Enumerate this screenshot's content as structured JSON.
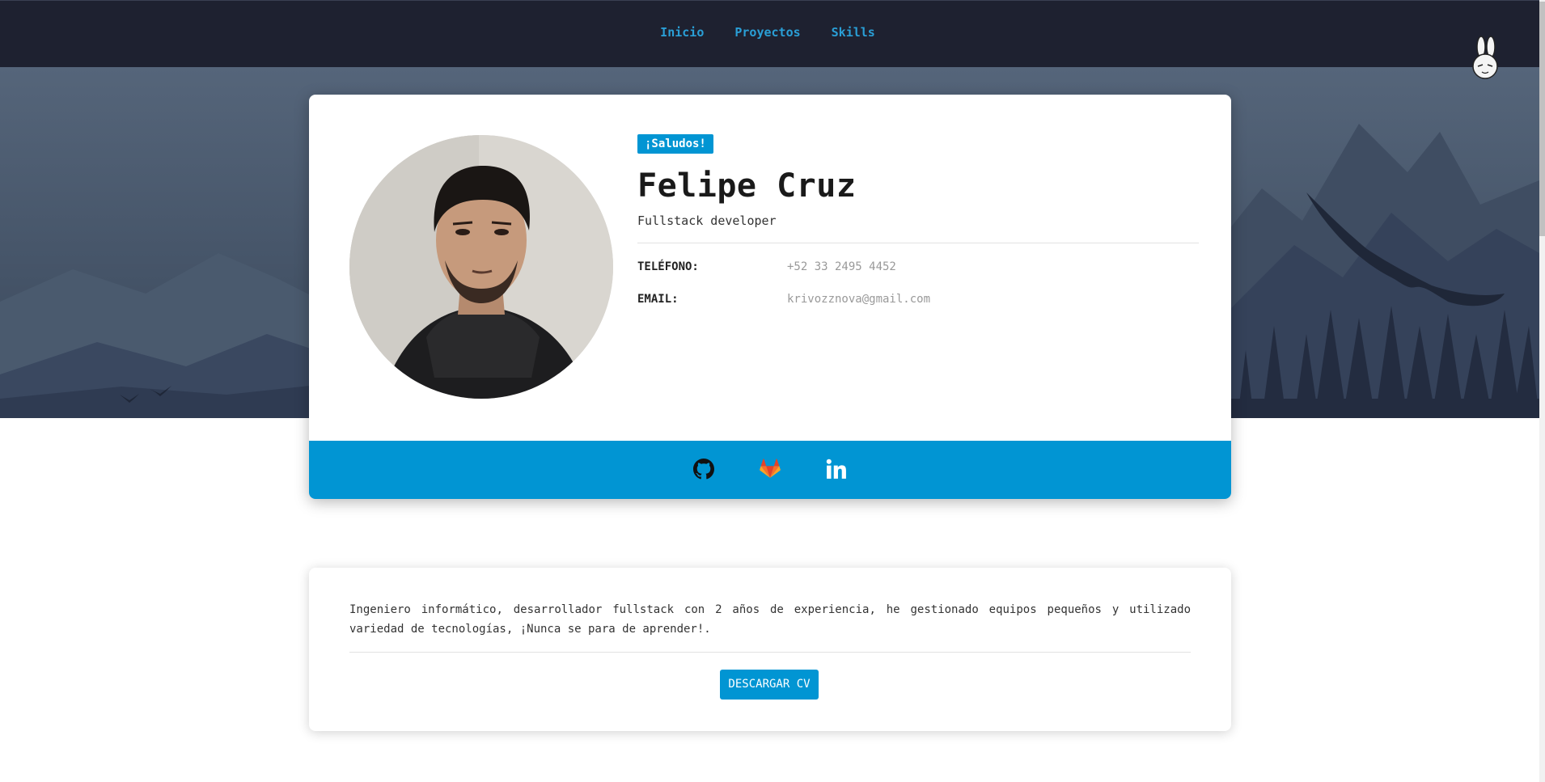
{
  "nav": {
    "links": [
      "Inicio",
      "Proyectos",
      "Skills"
    ]
  },
  "profile": {
    "badge": "¡Saludos!",
    "name": "Felipe Cruz",
    "role": "Fullstack developer",
    "phone_label": "TELÉFONO:",
    "phone_value": "+52 33 2495 4452",
    "email_label": "EMAIL:",
    "email_value": "krivozznova@gmail.com"
  },
  "social": {
    "icons": [
      "github-icon",
      "gitlab-icon",
      "linkedin-icon"
    ],
    "bar_color": "#0195d3"
  },
  "about": {
    "text": "Ingeniero informático, desarrollador fullstack con 2 años de experiencia, he gestionado equipos pequeños y utilizado variedad de tecnologías, ¡Nunca se para de aprender!.",
    "cv_button": "DESCARGAR CV"
  },
  "colors": {
    "accent": "#0195d3",
    "nav_bg": "#1e2130",
    "nav_link": "#2a9fd6"
  }
}
